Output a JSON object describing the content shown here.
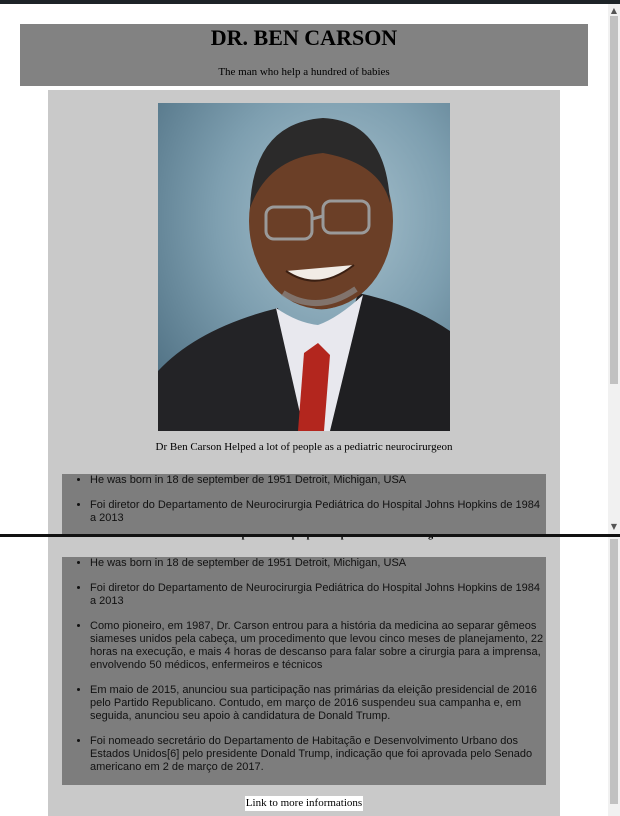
{
  "header": {
    "title": "DR. BEN CARSON",
    "subtitle": "The man who help a hundred of babies"
  },
  "portrait": {
    "caption": "Dr Ben Carson Helped a lot of people as a pediatric neurocirurgeon"
  },
  "facts": [
    "He was born in 18 de september de 1951 Detroit, Michigan, USA",
    "Foi diretor do Departamento de Neurocirurgia Pediátrica do Hospital Johns Hopkins de 1984 a 2013",
    "Como pioneiro, em 1987, Dr. Carson entrou para a história da medicina ao separar gêmeos siameses unidos pela cabeça, um procedimento que levou cinco meses de planejamento, 22 horas na execução, e mais 4 horas de descanso para falar sobre a cirurgia para a imprensa, envolvendo 50 médicos, enfermeiros e técnicos",
    "Em maio de 2015, anunciou sua participação nas primárias da eleição presidencial de 2016 pelo Partido Republicano. Contudo, em março de 2016 suspendeu sua campanha e, em seguida, anunciou seu apoio à candidatura de Donald Trump.",
    "Foi nomeado secretário do Departamento de Habitação e Desenvolvimento Urbano dos Estados Unidos[6] pelo presidente Donald Trump, indicação que foi aprovada pelo Senado americano em 2 de março de 2017."
  ],
  "link": {
    "label": "Link to more informations"
  },
  "scroll": {
    "up_icon": "triangle-up",
    "down_icon": "triangle-down"
  },
  "colors": {
    "header_bg": "#828282",
    "content_bg": "#c9c9c9",
    "facts_bg": "#7d7d7d"
  }
}
